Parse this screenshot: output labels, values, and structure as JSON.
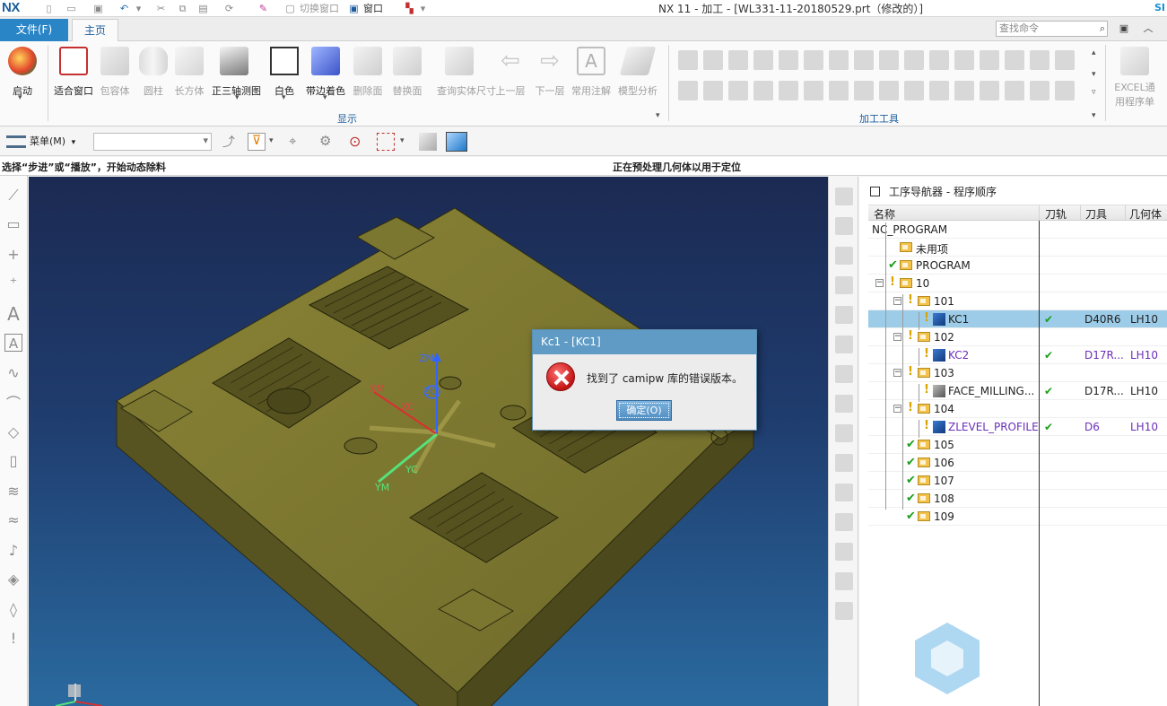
{
  "titlebar": {
    "logo": "NX",
    "title": "NX 11 - 加工 - [WL331-11-20180529.prt（修改的）]",
    "switch_window": "切换窗口",
    "window_menu": "窗口",
    "brand": "SI"
  },
  "tabs": {
    "file": "文件(F)",
    "home": "主页"
  },
  "search": {
    "placeholder": "查找命令"
  },
  "ribbon": {
    "buttons": [
      {
        "label": "启动"
      },
      {
        "label": "适合窗口"
      },
      {
        "label": "包容体"
      },
      {
        "label": "圆柱"
      },
      {
        "label": "长方体"
      },
      {
        "label": "正三轴测图"
      },
      {
        "label": "白色"
      },
      {
        "label": "带边着色"
      },
      {
        "label": "删除面"
      },
      {
        "label": "替换面"
      },
      {
        "label": "查询实体尺寸"
      },
      {
        "label": "上一层"
      },
      {
        "label": "下一层"
      },
      {
        "label": "常用注解"
      },
      {
        "label": "模型分析"
      }
    ],
    "group_display": "显示",
    "group_tools": "加工工具",
    "excel_label_1": "EXCEL通",
    "excel_label_2": "用程序单"
  },
  "toolbar2": {
    "menu": "菜单(M)"
  },
  "status": {
    "left": "选择“步进”或“播放”，开始动态除料",
    "center": "正在预处理几何体以用于定位"
  },
  "viewport": {
    "axis_zm": "ZM",
    "axis_xm": "XM",
    "axis_ym": "YM",
    "axis_xc": "XC",
    "axis_yc": "YC",
    "axis_zc": "ZC"
  },
  "navigator": {
    "title": "工序导航器 - 程序顺序",
    "columns": {
      "name": "名称",
      "path": "刀轨",
      "tool": "刀具",
      "geometry": "几何体"
    },
    "rows": [
      {
        "name": "NC_PROGRAM",
        "path": "",
        "tool": "",
        "geometry": ""
      },
      {
        "name": "未用项",
        "path": "",
        "tool": "",
        "geometry": ""
      },
      {
        "name": "PROGRAM",
        "path": "",
        "tool": "",
        "geometry": ""
      },
      {
        "name": "10",
        "path": "",
        "tool": "",
        "geometry": ""
      },
      {
        "name": "101",
        "path": "",
        "tool": "",
        "geometry": ""
      },
      {
        "name": "KC1",
        "path": "✔",
        "tool": "D40R6",
        "geometry": "LH10"
      },
      {
        "name": "102",
        "path": "",
        "tool": "",
        "geometry": ""
      },
      {
        "name": "KC2",
        "path": "✔",
        "tool": "D17R...",
        "geometry": "LH10"
      },
      {
        "name": "103",
        "path": "",
        "tool": "",
        "geometry": ""
      },
      {
        "name": "FACE_MILLING...",
        "path": "✔",
        "tool": "D17R...",
        "geometry": "LH10"
      },
      {
        "name": "104",
        "path": "",
        "tool": "",
        "geometry": ""
      },
      {
        "name": "ZLEVEL_PROFILE",
        "path": "✔",
        "tool": "D6",
        "geometry": "LH10"
      },
      {
        "name": "105",
        "path": "",
        "tool": "",
        "geometry": ""
      },
      {
        "name": "106",
        "path": "",
        "tool": "",
        "geometry": ""
      },
      {
        "name": "107",
        "path": "",
        "tool": "",
        "geometry": ""
      },
      {
        "name": "108",
        "path": "",
        "tool": "",
        "geometry": ""
      },
      {
        "name": "109",
        "path": "",
        "tool": "",
        "geometry": ""
      }
    ]
  },
  "dialog": {
    "title": "Kc1 - [KC1]",
    "message": "找到了 camipw 库的错误版本。",
    "ok": "确定(O)"
  },
  "colors": {
    "accent": "#2a85c6",
    "selection": "#9ccce8",
    "purple_op": "#6b2fb8",
    "part": "#6f6b28"
  }
}
